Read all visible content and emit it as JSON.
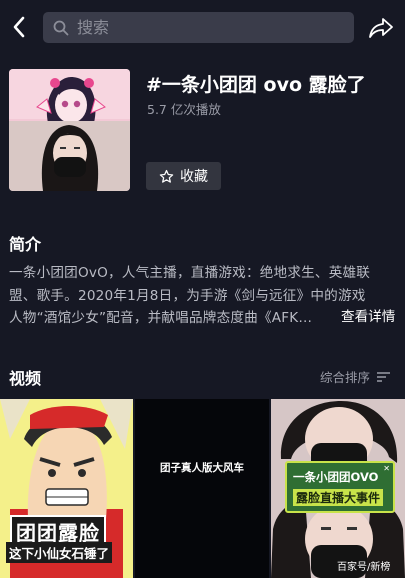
{
  "search": {
    "placeholder": "搜索"
  },
  "header": {
    "back_icon": "chevron-left-icon",
    "share_icon": "share-arrow-icon"
  },
  "topic": {
    "title": "#一条小团团 ovo 露脸了",
    "plays": "5.7 亿次播放",
    "favorite_label": "收藏"
  },
  "intro": {
    "heading": "简介",
    "lines": [
      "一条小团团OvO，人气主播，直播游戏：绝地求生、英雄联",
      "盟、歌手。2020年1月8日，为手游《剑与远征》中的游戏",
      "人物“酒馆少女”配音，并献唱品牌态度曲《AFK…"
    ],
    "more_label": "查看详情"
  },
  "videos": {
    "heading": "视频",
    "sort_label": "综合排序",
    "items": [
      {
        "caption_main": "团团露脸",
        "caption_sub": "这下小仙女石锤了"
      },
      {
        "caption": "团子真人版大风车"
      },
      {
        "caption_line1": "一条小团团OVO",
        "caption_line2": "露脸直播大事件",
        "watermark": "百家号/新榜"
      }
    ]
  },
  "colors": {
    "background": "#161824",
    "button": "#33353f",
    "muted_text": "#9a9ca7"
  }
}
